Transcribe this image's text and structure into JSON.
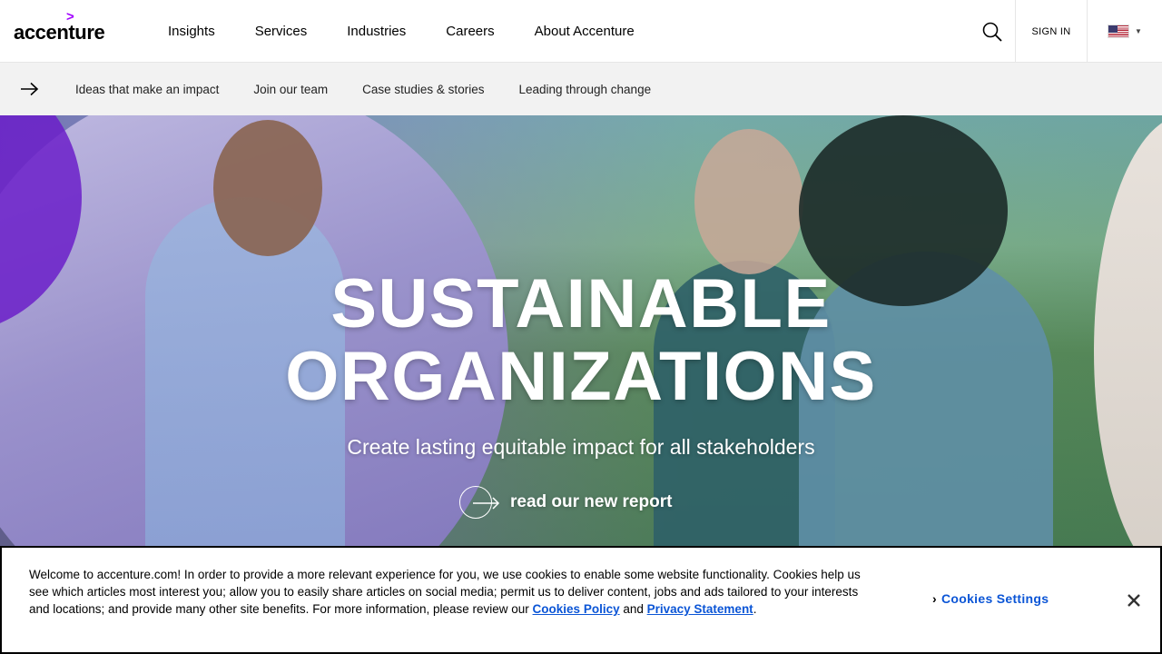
{
  "header": {
    "logo_text": "accenture",
    "logo_mark": ">",
    "nav": [
      {
        "label": "Insights"
      },
      {
        "label": "Services"
      },
      {
        "label": "Industries"
      },
      {
        "label": "Careers"
      },
      {
        "label": "About Accenture"
      }
    ],
    "signin_label": "SIGN IN",
    "search_icon": "search-icon",
    "locale_icon": "us-flag-icon"
  },
  "subnav": {
    "items": [
      {
        "label": "Ideas that make an impact"
      },
      {
        "label": "Join our team"
      },
      {
        "label": "Case studies & stories"
      },
      {
        "label": "Leading through change"
      }
    ]
  },
  "hero": {
    "title_line1": "SUSTAINABLE",
    "title_line2": "ORGANIZATIONS",
    "subtitle": "Create lasting equitable impact for all stakeholders",
    "cta_label": "read our new report"
  },
  "cookie": {
    "text_part1": "Welcome to accenture.com! In order to provide a more relevant experience for you, we use cookies to enable some website functionality. Cookies help us see which articles most interest you; allow you to easily share articles on social media; permit us to deliver content, jobs and ads tailored to your interests and locations; and provide many other site benefits. For more information, please review our ",
    "policy_link": "Cookies Policy",
    "and_text": " and ",
    "privacy_link": "Privacy Statement",
    "end_text": ".",
    "settings_label": "Cookies Settings",
    "close_icon": "close-icon"
  },
  "colors": {
    "brand_purple": "#a100ff",
    "link_blue": "#0b55d6",
    "subnav_bg": "#f2f2f2"
  }
}
